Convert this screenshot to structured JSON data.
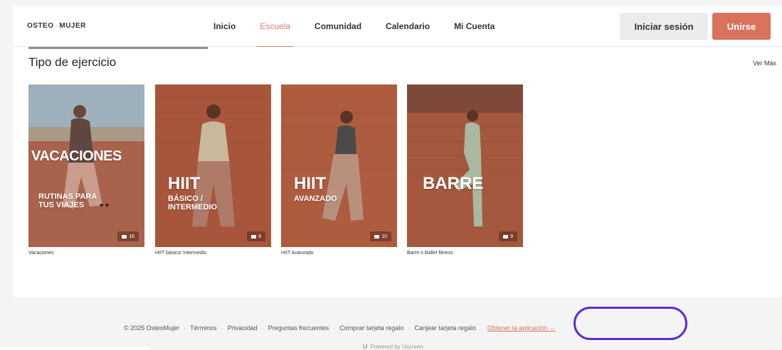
{
  "header": {
    "logo_left": "OSTEO",
    "logo_mid": "·",
    "logo_right": "MUJER",
    "nav": [
      "Inicio",
      "Escuela",
      "Comunidad",
      "Calendario",
      "Mi Cuenta"
    ],
    "active_nav": "Escuela",
    "login_label": "Iniciar sesión",
    "join_label": "Unirse"
  },
  "section": {
    "title": "Tipo de ejercicio",
    "see_more": "Ver Más"
  },
  "cards": [
    {
      "big": "VACACIONES",
      "sub": "RUTINAS PARA\nTUS VIAJES",
      "hearts": "♥ ♥",
      "count": "16",
      "caption": "Vacaciones"
    },
    {
      "big": "HIIT",
      "sub": "BÁSICO /\nINTERMEDIO",
      "count": "8",
      "caption": "HIIT básico/ Intermedio"
    },
    {
      "big": "HIIT",
      "sub": "AVANZADO",
      "count": "10",
      "caption": "HIIT Avanzado"
    },
    {
      "big": "BARRE",
      "sub": "",
      "count": "9",
      "caption": "Barre o Ballet fitness"
    }
  ],
  "footer": {
    "copyright": "© 2025 OsteoMujer",
    "links": [
      "Términos",
      "Privacidad",
      "Preguntas frecuentes",
      "Comprar tarjeta regalo",
      "Canjear tarjeta regalo"
    ],
    "app_link": "Obtener la aplicación →",
    "powered": "Powered by Uscreen",
    "powered_mark": "U"
  },
  "colors": {
    "accent": "#d9735e",
    "highlight": "#5b2cd6"
  }
}
